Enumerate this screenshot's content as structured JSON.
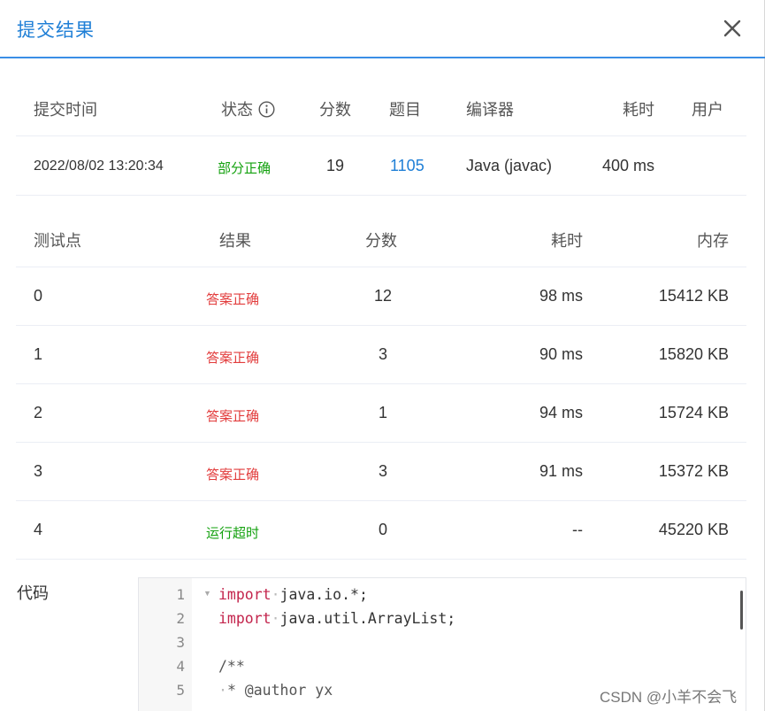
{
  "dialog": {
    "title": "提交结果"
  },
  "summary": {
    "headers": {
      "time": "提交时间",
      "status": "状态",
      "score": "分数",
      "problem": "题目",
      "compiler": "编译器",
      "duration": "耗时",
      "user": "用户"
    },
    "values": {
      "time": "2022/08/02 13:20:34",
      "status": "部分正确",
      "score": "19",
      "problem": "1105",
      "compiler": "Java (javac)",
      "duration": "400 ms",
      "user": ""
    }
  },
  "testcases": {
    "headers": {
      "id": "测试点",
      "result": "结果",
      "score": "分数",
      "duration": "耗时",
      "memory": "内存"
    },
    "rows": [
      {
        "id": "0",
        "result": "答案正确",
        "score": "12",
        "duration": "98 ms",
        "memory": "15412 KB"
      },
      {
        "id": "1",
        "result": "答案正确",
        "score": "3",
        "duration": "90 ms",
        "memory": "15820 KB"
      },
      {
        "id": "2",
        "result": "答案正确",
        "score": "1",
        "duration": "94 ms",
        "memory": "15724 KB"
      },
      {
        "id": "3",
        "result": "答案正确",
        "score": "3",
        "duration": "91 ms",
        "memory": "15372 KB"
      },
      {
        "id": "4",
        "result": "运行超时",
        "score": "0",
        "duration": "--",
        "memory": "45220 KB"
      }
    ]
  },
  "code": {
    "label": "代码",
    "lines": [
      {
        "n": "1",
        "kw": "import",
        "text": "java.io.*;"
      },
      {
        "n": "2",
        "kw": "import",
        "text": "java.util.ArrayList;"
      },
      {
        "n": "3",
        "kw": "",
        "text": ""
      },
      {
        "n": "4",
        "kw": "",
        "text": "/**"
      },
      {
        "n": "5",
        "kw": "",
        "text": "* @author yx"
      }
    ]
  },
  "watermark": "CSDN @小羊不会飞",
  "colors": {
    "accent": "#1f7fd6",
    "correct_red": "#e23c3c",
    "partial_green": "#13a10e"
  }
}
